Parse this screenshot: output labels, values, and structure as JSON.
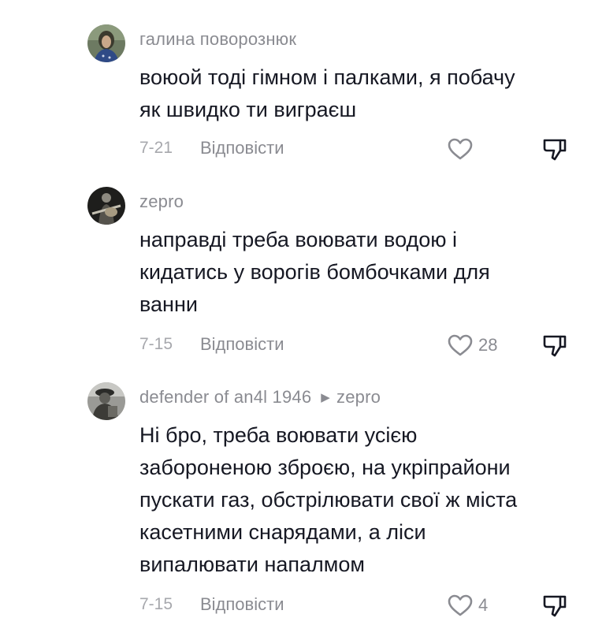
{
  "comments": [
    {
      "username": "галина поворознюк",
      "reply_to": "",
      "text_lines": [
        "воюой тоді гімном і палками, я побачу",
        "як швидко ти виграєш"
      ],
      "date": "7-21",
      "reply_label": "Відповісти",
      "likes": "",
      "avatar": "elderly-woman-avatar"
    },
    {
      "username": "zepro",
      "reply_to": "",
      "text_lines": [
        "направді треба воювати водою і",
        "кидатись у ворогів бомбочками для",
        "ванни"
      ],
      "date": "7-15",
      "reply_label": "Відповісти",
      "likes": "28",
      "avatar": "guitarist-avatar"
    },
    {
      "username": "defender of an4l 1946",
      "reply_to": "zepro",
      "text_lines": [
        "Ні бро, треба воювати усією",
        "забороненою зброєю, на укріпрайони",
        "пускати газ, обстрілювати свої ж міста",
        "касетними снарядами, а ліси",
        "випалювати напалмом"
      ],
      "date": "7-15",
      "reply_label": "Відповісти",
      "likes": "4",
      "avatar": "soldier-avatar"
    }
  ],
  "icons": {
    "like": "heart-outline-icon",
    "dislike": "thumbs-down-icon",
    "reply_arrow": "triangle-right-icon"
  },
  "colors": {
    "text": "#161823",
    "secondary": "#8a8b91",
    "date": "#a7a8ad"
  }
}
